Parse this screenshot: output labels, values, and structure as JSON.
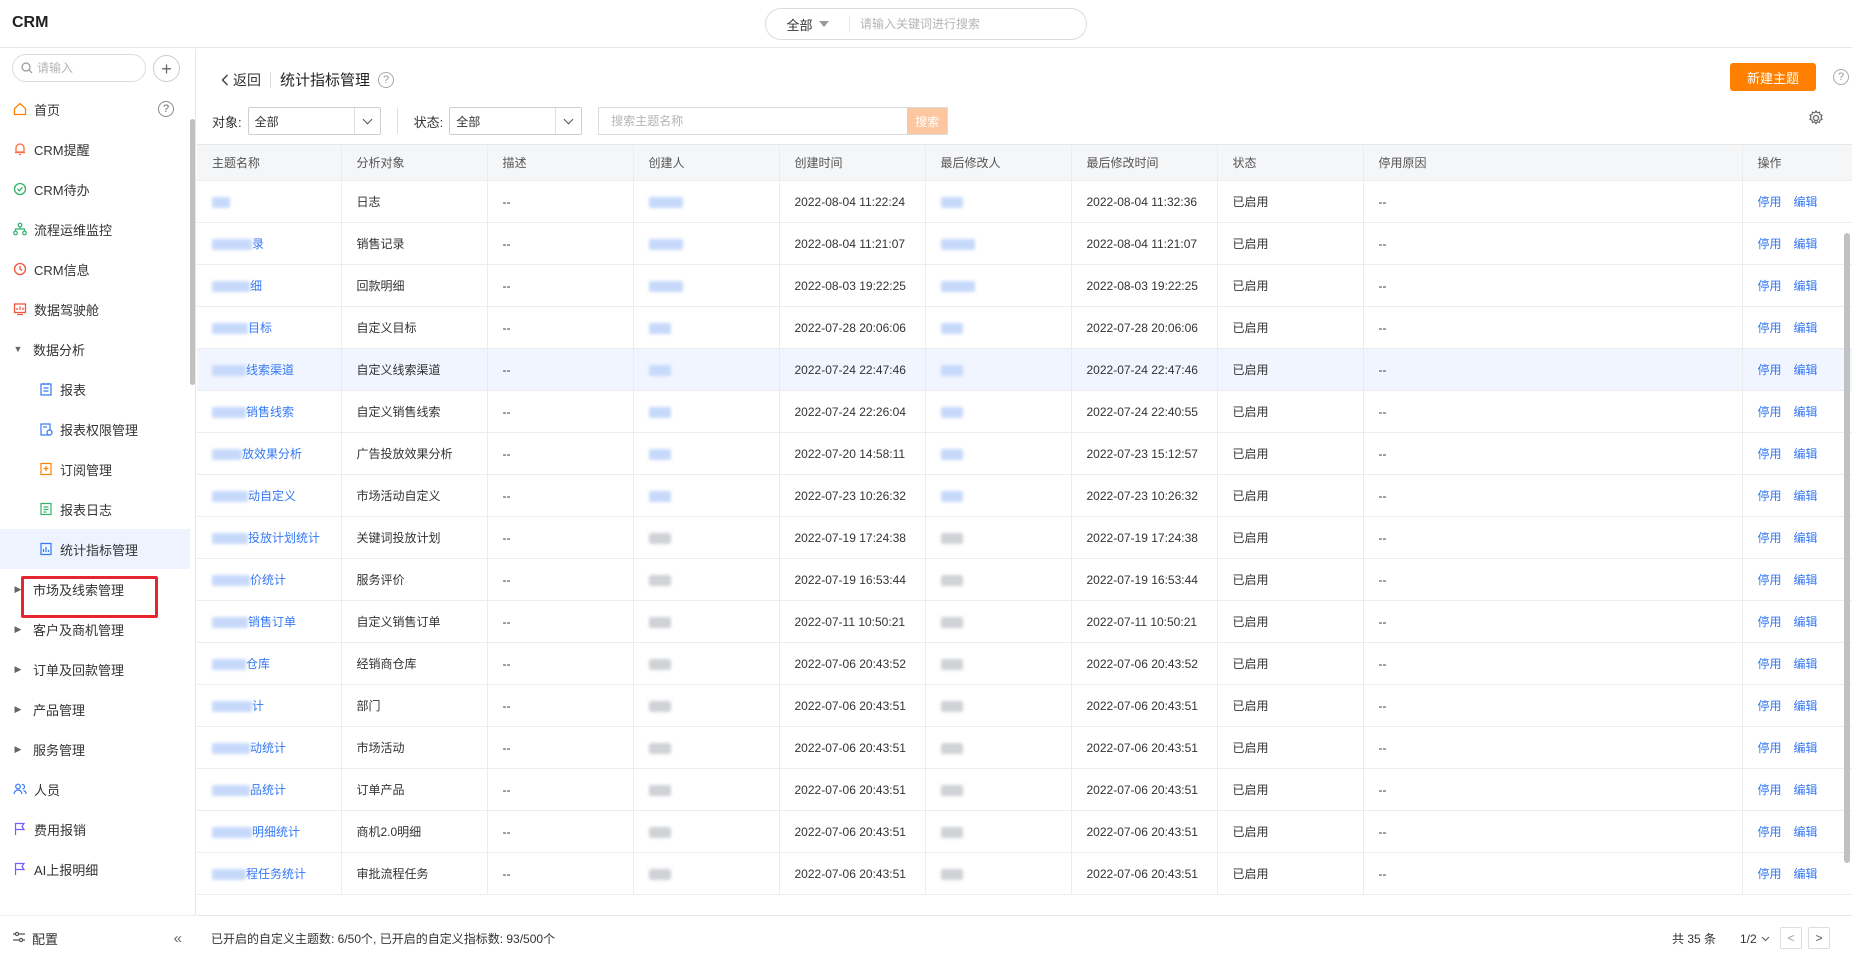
{
  "app": {
    "title": "CRM"
  },
  "global_search": {
    "scope": "全部",
    "placeholder": "请输入关键词进行搜索"
  },
  "sidebar": {
    "search_placeholder": "请输入",
    "add_label": "+",
    "help_label": "?",
    "items": [
      {
        "label": "首页",
        "icon": "home-icon"
      },
      {
        "label": "CRM提醒",
        "icon": "bell-icon"
      },
      {
        "label": "CRM待办",
        "icon": "check-circle-icon"
      },
      {
        "label": "流程运维监控",
        "icon": "flow-icon"
      },
      {
        "label": "CRM信息",
        "icon": "clock-icon"
      },
      {
        "label": "数据驾驶舱",
        "icon": "dashboard-icon"
      },
      {
        "label": "数据分析",
        "icon": "caret-down-icon"
      },
      {
        "label": "报表",
        "icon": "report-icon"
      },
      {
        "label": "报表权限管理",
        "icon": "report-permission-icon"
      },
      {
        "label": "订阅管理",
        "icon": "subscribe-icon"
      },
      {
        "label": "报表日志",
        "icon": "log-icon"
      },
      {
        "label": "统计指标管理",
        "icon": "metrics-icon"
      },
      {
        "label": "市场及线索管理",
        "icon": "caret-right-icon"
      },
      {
        "label": "客户及商机管理",
        "icon": "caret-right-icon"
      },
      {
        "label": "订单及回款管理",
        "icon": "caret-right-icon"
      },
      {
        "label": "产品管理",
        "icon": "caret-right-icon"
      },
      {
        "label": "服务管理",
        "icon": "caret-right-icon"
      },
      {
        "label": "人员",
        "icon": "people-icon"
      },
      {
        "label": "费用报销",
        "icon": "flag-icon"
      },
      {
        "label": "AI上报明细",
        "icon": "flag-icon"
      }
    ],
    "bottom": {
      "label": "配置",
      "collapse": "«"
    }
  },
  "page": {
    "back_label": "返回",
    "title": "统计指标管理",
    "help_label": "?",
    "new_button": "新建主题",
    "filters": {
      "object_label": "对象:",
      "object_value": "全部",
      "status_label": "状态:",
      "status_value": "全部",
      "search_placeholder": "搜索主题名称",
      "search_button": "搜索"
    }
  },
  "table": {
    "columns": [
      "主题名称",
      "分析对象",
      "描述",
      "创建人",
      "创建时间",
      "最后修改人",
      "最后修改时间",
      "状态",
      "停用原因",
      "操作"
    ],
    "rows": [
      {
        "name": "",
        "object": "日志",
        "desc": "--",
        "created": "2022-08-04 11:22:24",
        "modified": "2022-08-04 11:32:36",
        "status": "已启用",
        "reason": "--"
      },
      {
        "name": "录",
        "object": "销售记录",
        "desc": "--",
        "created": "2022-08-04 11:21:07",
        "modified": "2022-08-04 11:21:07",
        "status": "已启用",
        "reason": "--"
      },
      {
        "name": "细",
        "object": "回款明细",
        "desc": "--",
        "created": "2022-08-03 19:22:25",
        "modified": "2022-08-03 19:22:25",
        "status": "已启用",
        "reason": "--"
      },
      {
        "name": "目标",
        "object": "自定义目标",
        "desc": "--",
        "created": "2022-07-28 20:06:06",
        "modified": "2022-07-28 20:06:06",
        "status": "已启用",
        "reason": "--"
      },
      {
        "name": "线索渠道",
        "object": "自定义线索渠道",
        "desc": "--",
        "created": "2022-07-24 22:47:46",
        "modified": "2022-07-24 22:47:46",
        "status": "已启用",
        "reason": "--"
      },
      {
        "name": "销售线索",
        "object": "自定义销售线索",
        "desc": "--",
        "created": "2022-07-24 22:26:04",
        "modified": "2022-07-24 22:40:55",
        "status": "已启用",
        "reason": "--"
      },
      {
        "name": "放效果分析",
        "object": "广告投放效果分析",
        "desc": "--",
        "created": "2022-07-20 14:58:11",
        "modified": "2022-07-23 15:12:57",
        "status": "已启用",
        "reason": "--"
      },
      {
        "name": "动自定义",
        "object": "市场活动自定义",
        "desc": "--",
        "created": "2022-07-23 10:26:32",
        "modified": "2022-07-23 10:26:32",
        "status": "已启用",
        "reason": "--"
      },
      {
        "name": "投放计划统计",
        "object": "关键词投放计划",
        "desc": "--",
        "created": "2022-07-19 17:24:38",
        "modified": "2022-07-19 17:24:38",
        "status": "已启用",
        "reason": "--"
      },
      {
        "name": "价统计",
        "object": "服务评价",
        "desc": "--",
        "created": "2022-07-19 16:53:44",
        "modified": "2022-07-19 16:53:44",
        "status": "已启用",
        "reason": "--"
      },
      {
        "name": "销售订单",
        "object": "自定义销售订单",
        "desc": "--",
        "created": "2022-07-11 10:50:21",
        "modified": "2022-07-11 10:50:21",
        "status": "已启用",
        "reason": "--"
      },
      {
        "name": "仓库",
        "object": "经销商仓库",
        "desc": "--",
        "created": "2022-07-06 20:43:52",
        "modified": "2022-07-06 20:43:52",
        "status": "已启用",
        "reason": "--"
      },
      {
        "name": "计",
        "object": "部门",
        "desc": "--",
        "created": "2022-07-06 20:43:51",
        "modified": "2022-07-06 20:43:51",
        "status": "已启用",
        "reason": "--"
      },
      {
        "name": "动统计",
        "object": "市场活动",
        "desc": "--",
        "created": "2022-07-06 20:43:51",
        "modified": "2022-07-06 20:43:51",
        "status": "已启用",
        "reason": "--"
      },
      {
        "name": "品统计",
        "object": "订单产品",
        "desc": "--",
        "created": "2022-07-06 20:43:51",
        "modified": "2022-07-06 20:43:51",
        "status": "已启用",
        "reason": "--"
      },
      {
        "name": "明细统计",
        "object": "商机2.0明细",
        "desc": "--",
        "created": "2022-07-06 20:43:51",
        "modified": "2022-07-06 20:43:51",
        "status": "已启用",
        "reason": "--"
      },
      {
        "name": "程任务统计",
        "object": "审批流程任务",
        "desc": "--",
        "created": "2022-07-06 20:43:51",
        "modified": "2022-07-06 20:43:51",
        "status": "已启用",
        "reason": "--"
      }
    ],
    "actions": {
      "disable": "停用",
      "edit": "编辑"
    }
  },
  "footer": {
    "info": "已开启的自定义主题数: 6/50个, 已开启的自定义指标数: 93/500个",
    "total": "共 35 条",
    "page": "1/2",
    "prev": "<",
    "next": ">"
  },
  "colors": {
    "accent": "#ff8000",
    "link": "#3478f6",
    "highlight": "#e5262e"
  }
}
